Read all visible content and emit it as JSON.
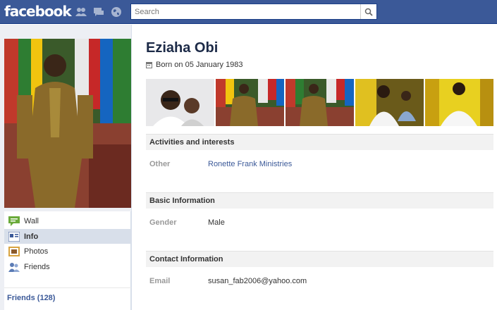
{
  "header": {
    "logo": "facebook",
    "search": {
      "placeholder": "Search"
    }
  },
  "profile": {
    "name": "Eziaha Obi",
    "birth": "Born on 05 January 1983"
  },
  "sidebar": {
    "items": [
      {
        "label": "Wall"
      },
      {
        "label": "Info"
      },
      {
        "label": "Photos"
      },
      {
        "label": "Friends"
      }
    ],
    "friends_link": "Friends (128)"
  },
  "sections": {
    "activities": {
      "title": "Activities and interests",
      "rows": [
        {
          "label": "Other",
          "value": "Ronette Frank Ministries"
        }
      ]
    },
    "basic": {
      "title": "Basic Information",
      "rows": [
        {
          "label": "Gender",
          "value": "Male"
        }
      ]
    },
    "contact": {
      "title": "Contact Information",
      "rows": [
        {
          "label": "Email",
          "value": "susan_fab2006@yahoo.com"
        }
      ]
    }
  },
  "colors": {
    "brand": "#3b5998",
    "nav_active": "#d8dfea",
    "section_bg": "#f2f2f2"
  }
}
